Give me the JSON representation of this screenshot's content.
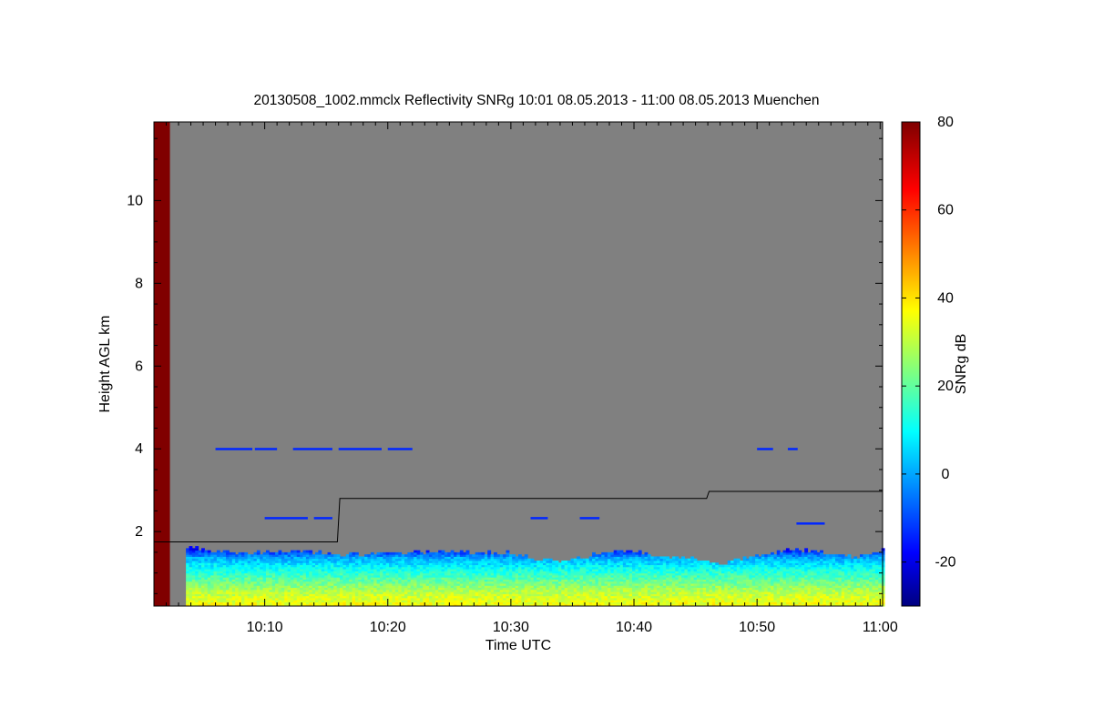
{
  "chart_data": {
    "type": "heatmap",
    "title": "20130508_1002.mmclx Reflectivity SNRg   10:01 08.05.2013 - 11:00 08.05.2013 Muenchen",
    "xlabel": "Time UTC",
    "ylabel": "Height AGL km",
    "x_unit": "minutes after 10:00 UTC",
    "xlim": [
      1.0,
      60.2
    ],
    "ylim": [
      0.2,
      11.9
    ],
    "x_ticks": [
      {
        "value": 10,
        "label": "10:10"
      },
      {
        "value": 20,
        "label": "10:20"
      },
      {
        "value": 30,
        "label": "10:30"
      },
      {
        "value": 40,
        "label": "10:40"
      },
      {
        "value": 50,
        "label": "10:50"
      },
      {
        "value": 60,
        "label": "11:00"
      }
    ],
    "y_ticks": [
      {
        "value": 2,
        "label": "2"
      },
      {
        "value": 4,
        "label": "4"
      },
      {
        "value": 6,
        "label": "6"
      },
      {
        "value": 8,
        "label": "8"
      },
      {
        "value": 10,
        "label": "10"
      }
    ],
    "colorbar": {
      "label": "SNRg dB",
      "range": [
        -30,
        80
      ],
      "ticks": [
        {
          "value": -20,
          "label": "-20"
        },
        {
          "value": 0,
          "label": "0"
        },
        {
          "value": 20,
          "label": "20"
        },
        {
          "value": 40,
          "label": "40"
        },
        {
          "value": 60,
          "label": "60"
        },
        {
          "value": 80,
          "label": "80"
        }
      ]
    },
    "colors": {
      "background_nodata": "#808080",
      "saturated_strip": "#800000",
      "boundary_line": "#000000"
    },
    "saturated_strip_x": [
      1.0,
      2.3
    ],
    "boundary_layer_top_km": [
      {
        "t": 1.0,
        "h": 1.75
      },
      {
        "t": 15.9,
        "h": 1.75
      },
      {
        "t": 16.1,
        "h": 2.8
      },
      {
        "t": 45.9,
        "h": 2.8
      },
      {
        "t": 46.1,
        "h": 2.97
      },
      {
        "t": 60.2,
        "h": 2.97
      }
    ],
    "cloud_layer_top_km": [
      {
        "t": 3.6,
        "h": 1.6
      },
      {
        "t": 6,
        "h": 1.5
      },
      {
        "t": 9,
        "h": 1.45
      },
      {
        "t": 12,
        "h": 1.52
      },
      {
        "t": 15,
        "h": 1.45
      },
      {
        "t": 18,
        "h": 1.42
      },
      {
        "t": 21,
        "h": 1.45
      },
      {
        "t": 24,
        "h": 1.5
      },
      {
        "t": 27,
        "h": 1.46
      },
      {
        "t": 30,
        "h": 1.45
      },
      {
        "t": 32,
        "h": 1.3
      },
      {
        "t": 34,
        "h": 1.25
      },
      {
        "t": 36,
        "h": 1.38
      },
      {
        "t": 38,
        "h": 1.52
      },
      {
        "t": 40,
        "h": 1.48
      },
      {
        "t": 43,
        "h": 1.35
      },
      {
        "t": 45,
        "h": 1.3
      },
      {
        "t": 47,
        "h": 1.2
      },
      {
        "t": 50,
        "h": 1.42
      },
      {
        "t": 53,
        "h": 1.55
      },
      {
        "t": 56,
        "h": 1.45
      },
      {
        "t": 58,
        "h": 1.35
      },
      {
        "t": 60.2,
        "h": 1.55
      }
    ],
    "layer_snr_profile": [
      {
        "h": 0.2,
        "snr": 38
      },
      {
        "h": 0.5,
        "snr": 32
      },
      {
        "h": 0.8,
        "snr": 22
      },
      {
        "h": 1.1,
        "snr": 12
      },
      {
        "h": 1.35,
        "snr": 2
      },
      {
        "h": 1.55,
        "snr": -15
      }
    ],
    "echo_band_4km": [
      {
        "t0": 6.0,
        "t1": 9.0,
        "h": 4.0
      },
      {
        "t0": 9.2,
        "t1": 11.0,
        "h": 4.0
      },
      {
        "t0": 12.3,
        "t1": 15.5,
        "h": 4.0
      },
      {
        "t0": 16.0,
        "t1": 19.5,
        "h": 4.0
      },
      {
        "t0": 20.0,
        "t1": 22.0,
        "h": 4.0
      },
      {
        "t0": 50.0,
        "t1": 51.3,
        "h": 4.0
      },
      {
        "t0": 52.5,
        "t1": 53.3,
        "h": 4.0
      }
    ],
    "echo_band_2_3km": [
      {
        "t0": 10.0,
        "t1": 13.5,
        "h": 2.33
      },
      {
        "t0": 14.0,
        "t1": 15.5,
        "h": 2.33
      },
      {
        "t0": 31.6,
        "t1": 33.0,
        "h": 2.33
      },
      {
        "t0": 35.6,
        "t1": 37.2,
        "h": 2.33
      },
      {
        "t0": 53.2,
        "t1": 55.5,
        "h": 2.2
      }
    ]
  }
}
